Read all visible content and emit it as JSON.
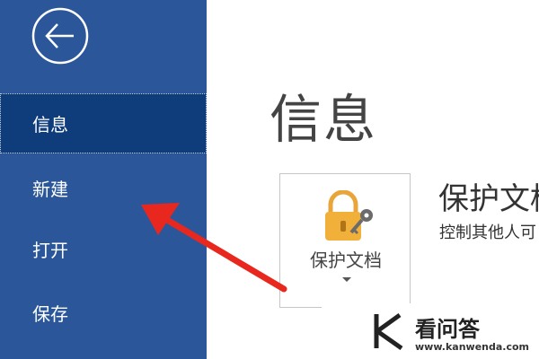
{
  "sidebar": {
    "back_icon": "back-arrow-icon",
    "items": [
      {
        "label": "信息",
        "active": true
      },
      {
        "label": "新建",
        "active": false
      },
      {
        "label": "打开",
        "active": false
      },
      {
        "label": "保存",
        "active": false
      }
    ]
  },
  "main": {
    "title": "信息",
    "protect_card": {
      "label": "保护文档",
      "icon": "lock-key-icon"
    },
    "protect_heading": "保护文档",
    "protect_desc": "控制其他人可"
  },
  "watermark": {
    "name": "看问答",
    "url": "www.kanwenda.com"
  },
  "colors": {
    "sidebar": "#2b579a",
    "sidebar_active": "#0f3c7b",
    "annotation_arrow": "#e8281e",
    "lock": "#f0b03a"
  }
}
